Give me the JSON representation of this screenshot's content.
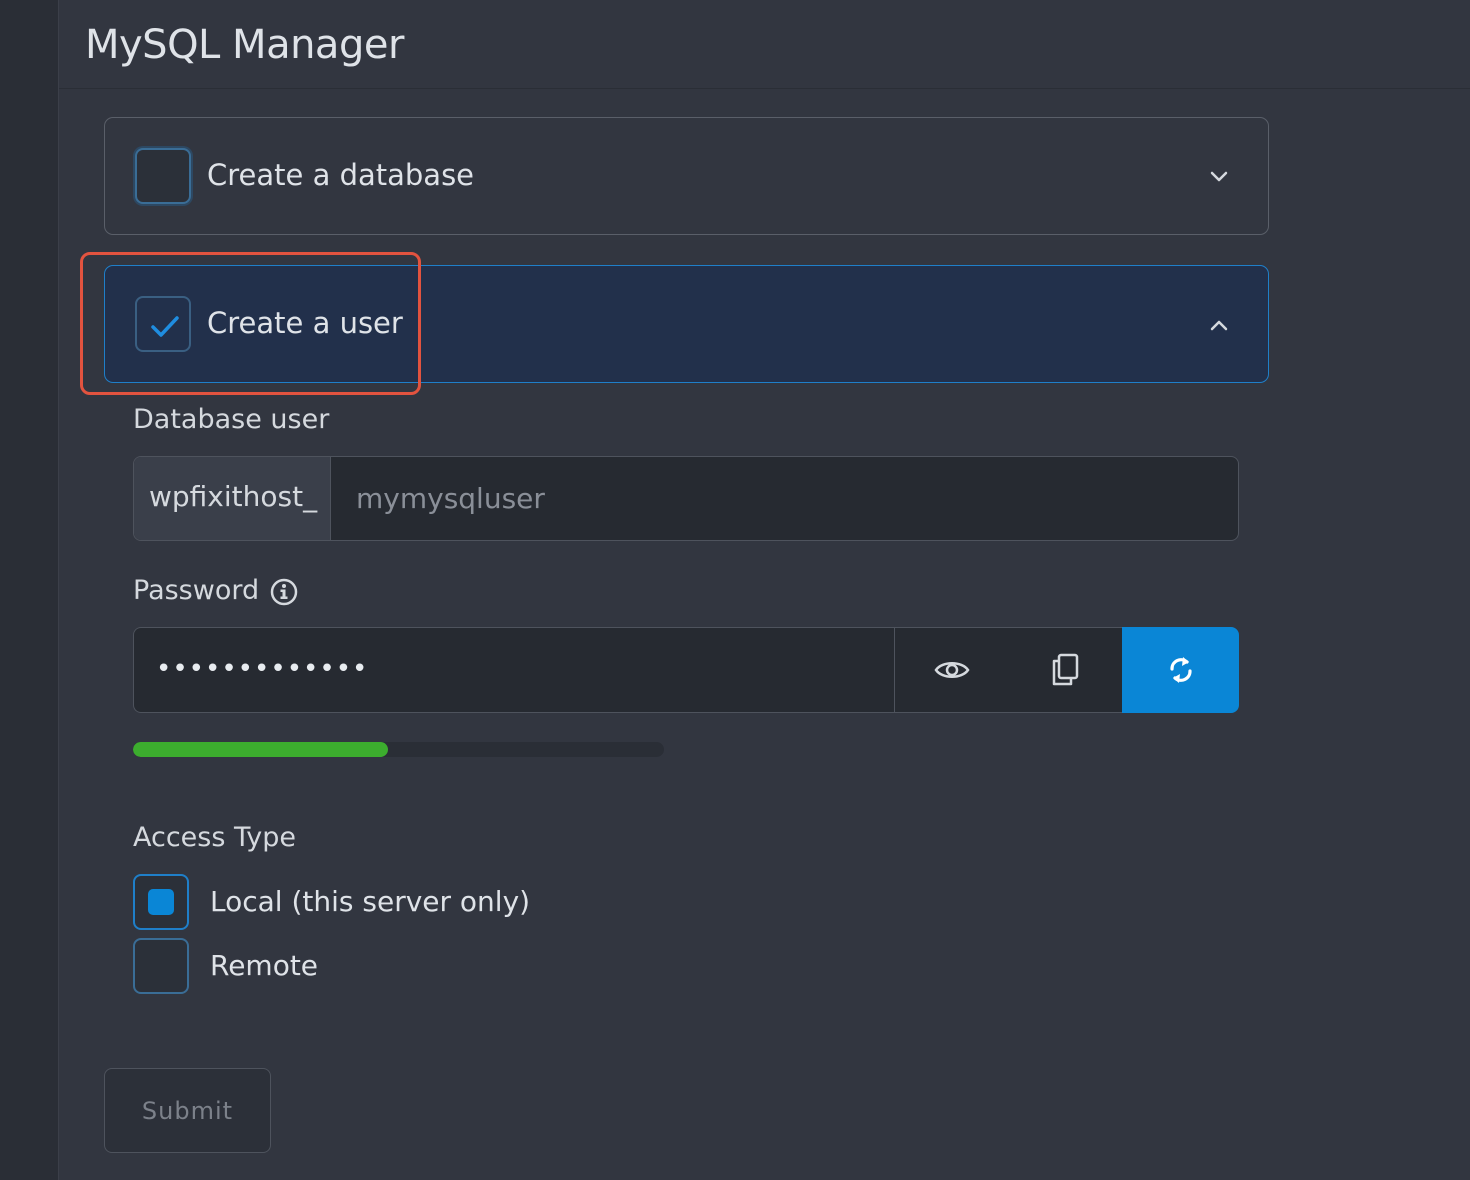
{
  "page": {
    "title": "MySQL Manager"
  },
  "sections": {
    "create_database": {
      "label": "Create a database",
      "checked": false,
      "expanded": false,
      "chevron_icon": "chevron-down-icon"
    },
    "create_user": {
      "label": "Create a user",
      "checked": true,
      "expanded": true,
      "chevron_icon": "chevron-up-icon"
    }
  },
  "form": {
    "database_user": {
      "label": "Database user",
      "prefix": "wpfixithost_",
      "placeholder": "mymysqluser",
      "value": ""
    },
    "password": {
      "label": "Password",
      "masked_value": "•••••••••••••",
      "info_icon": "info-icon",
      "buttons": [
        "eye-icon",
        "copy-icon",
        "refresh-icon"
      ],
      "strength_percent": 48
    },
    "access_type": {
      "label": "Access Type",
      "options": [
        {
          "label": "Local (this server only)",
          "selected": true
        },
        {
          "label": "Remote",
          "selected": false
        }
      ]
    },
    "submit_label": "Submit"
  },
  "colors": {
    "accent": "#0a86d6",
    "highlight": "#e2533f",
    "strength": "#3cad2e",
    "active_section_bg": "#22304b"
  }
}
